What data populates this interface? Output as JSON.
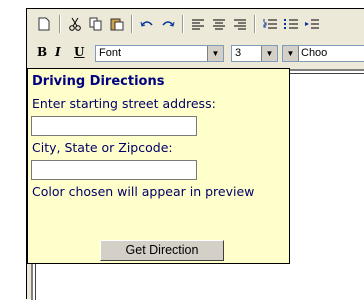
{
  "toolbar": {
    "icons": [
      "new-document-icon",
      "cut-icon",
      "copy-icon",
      "paste-icon",
      "undo-icon",
      "redo-icon",
      "align-left-icon",
      "align-center-icon",
      "align-right-icon",
      "ordered-list-icon",
      "unordered-list-icon",
      "indent-icon"
    ]
  },
  "format_bar": {
    "bold_label": "B",
    "italic_label": "I",
    "underline_label": "U",
    "font_value": "Font",
    "size_value": "3",
    "color_value": "Choo"
  },
  "form": {
    "title": "Driving Directions",
    "start_label": "Enter starting street address:",
    "city_label": "City, State or Zipcode:",
    "note": "Color chosen will appear in preview",
    "button_label": "Get Direction"
  }
}
